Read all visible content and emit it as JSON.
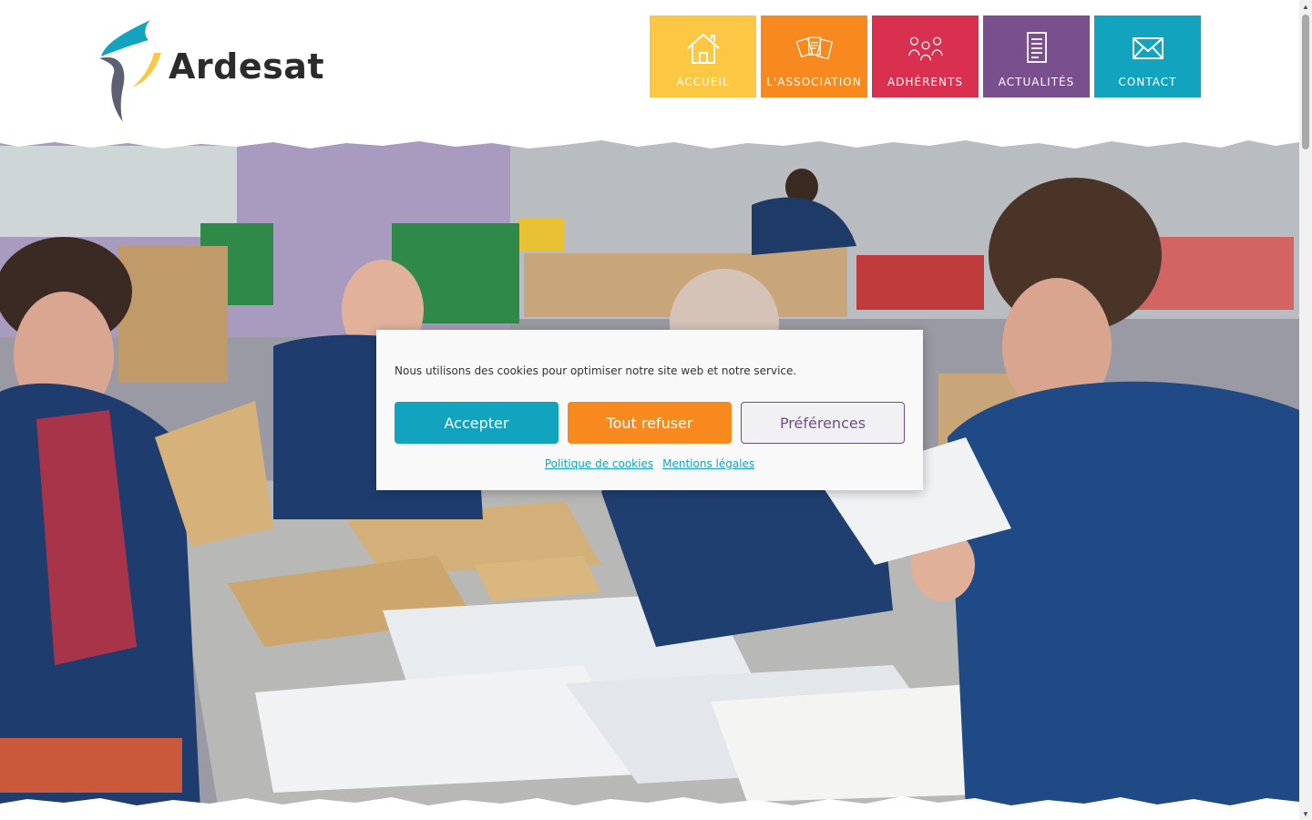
{
  "brand": {
    "name": "Ardesat",
    "colors": {
      "teal": "#12a4bf",
      "yellow": "#fcc743",
      "grey": "#5d5f73",
      "dark": "#2b2b2b"
    }
  },
  "nav": {
    "items": [
      {
        "label": "ACCUEIL",
        "icon": "house-icon",
        "color": "#fcc743"
      },
      {
        "label": "L'ASSOCIATION",
        "icon": "documents-icon",
        "color": "#f7891f"
      },
      {
        "label": "ADHÉRENTS",
        "icon": "people-icon",
        "color": "#d93050"
      },
      {
        "label": "ACTUALITÉS",
        "icon": "notepad-icon",
        "color": "#7a4f8e"
      },
      {
        "label": "CONTACT",
        "icon": "envelope-icon",
        "color": "#12a4bf"
      }
    ]
  },
  "hero": {
    "image": "photo-workers-sorting-mail"
  },
  "cookie": {
    "message": "Nous utilisons des cookies pour optimiser notre site web et notre service.",
    "accept_label": "Accepter",
    "refuse_label": "Tout refuser",
    "prefs_label": "Préférences",
    "policy_link": "Politique de cookies",
    "legal_link": "Mentions légales"
  }
}
